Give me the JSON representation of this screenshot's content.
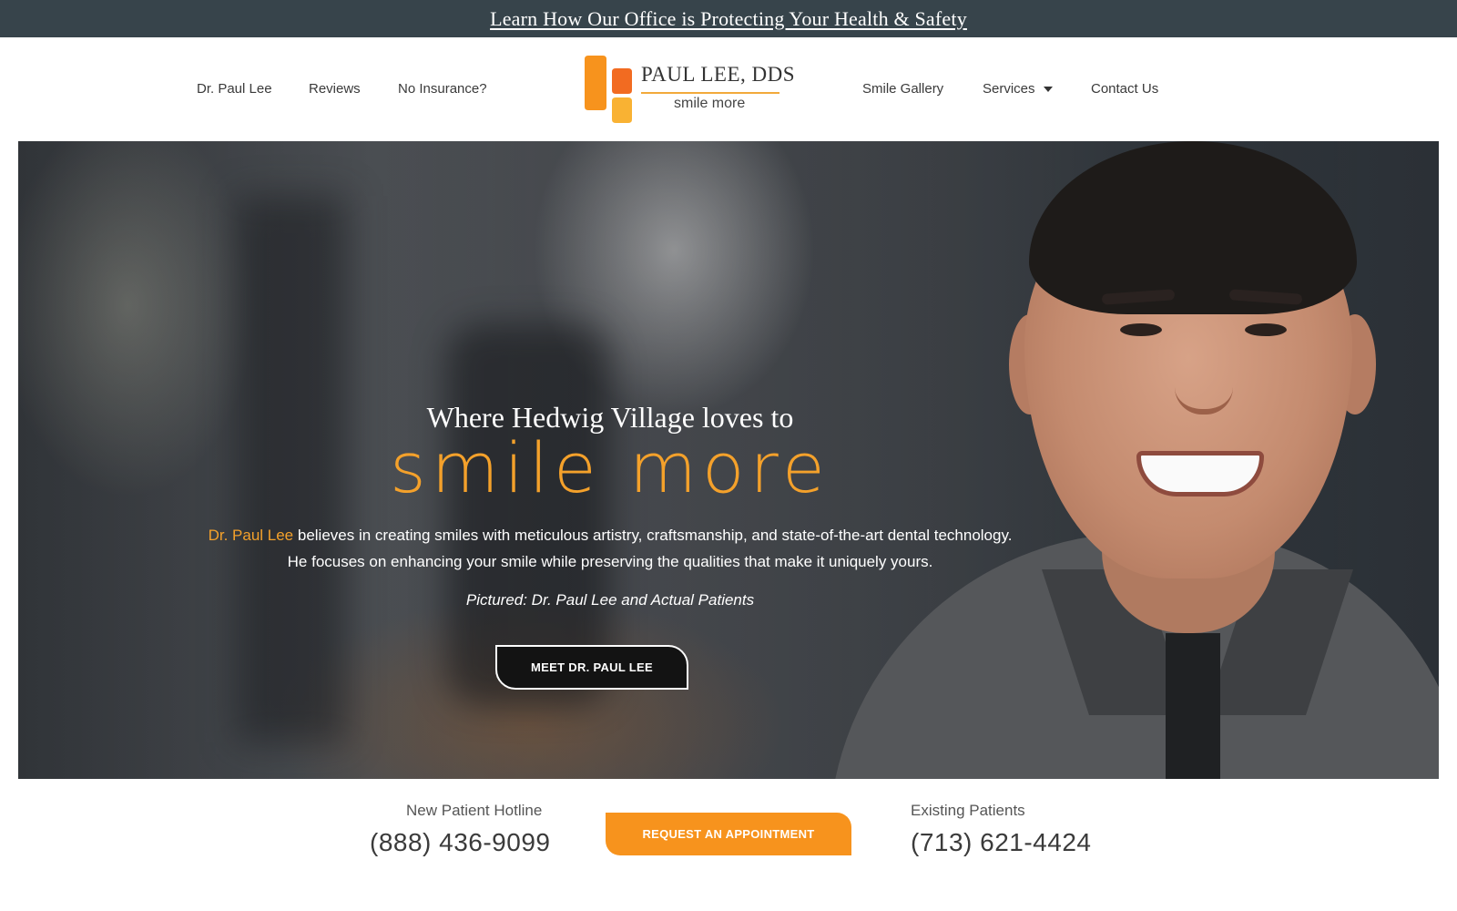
{
  "announcement": {
    "link_text": "Learn How Our Office is Protecting Your Health & Safety"
  },
  "nav": {
    "left": [
      "Dr. Paul Lee",
      "Reviews",
      "No Insurance?"
    ],
    "right": [
      "Smile Gallery",
      "Services",
      "Contact Us"
    ]
  },
  "logo": {
    "name": "PAUL LEE, DDS",
    "tagline": "smile more",
    "colors": [
      "#f7931d",
      "#f26b21",
      "#f9b233"
    ]
  },
  "hero": {
    "kicker": "Where Hedwig Village loves to",
    "title": "smile more",
    "desc_highlight": "Dr. Paul Lee",
    "desc_rest": " believes in creating smiles with meticulous artistry, craftsmanship, and state-of-the-art dental technology. He focuses on enhancing your smile while preserving the qualities that make it uniquely yours.",
    "caption": "Pictured: Dr. Paul Lee and Actual Patients",
    "button": "MEET DR. PAUL LEE"
  },
  "contact": {
    "new_label": "New Patient Hotline",
    "new_phone": "(888) 436-9099",
    "cta": "REQUEST AN APPOINTMENT",
    "existing_label": "Existing Patients",
    "existing_phone": "(713) 621-4424"
  },
  "colors": {
    "accent": "#f7931d",
    "topbar": "#37444b"
  }
}
